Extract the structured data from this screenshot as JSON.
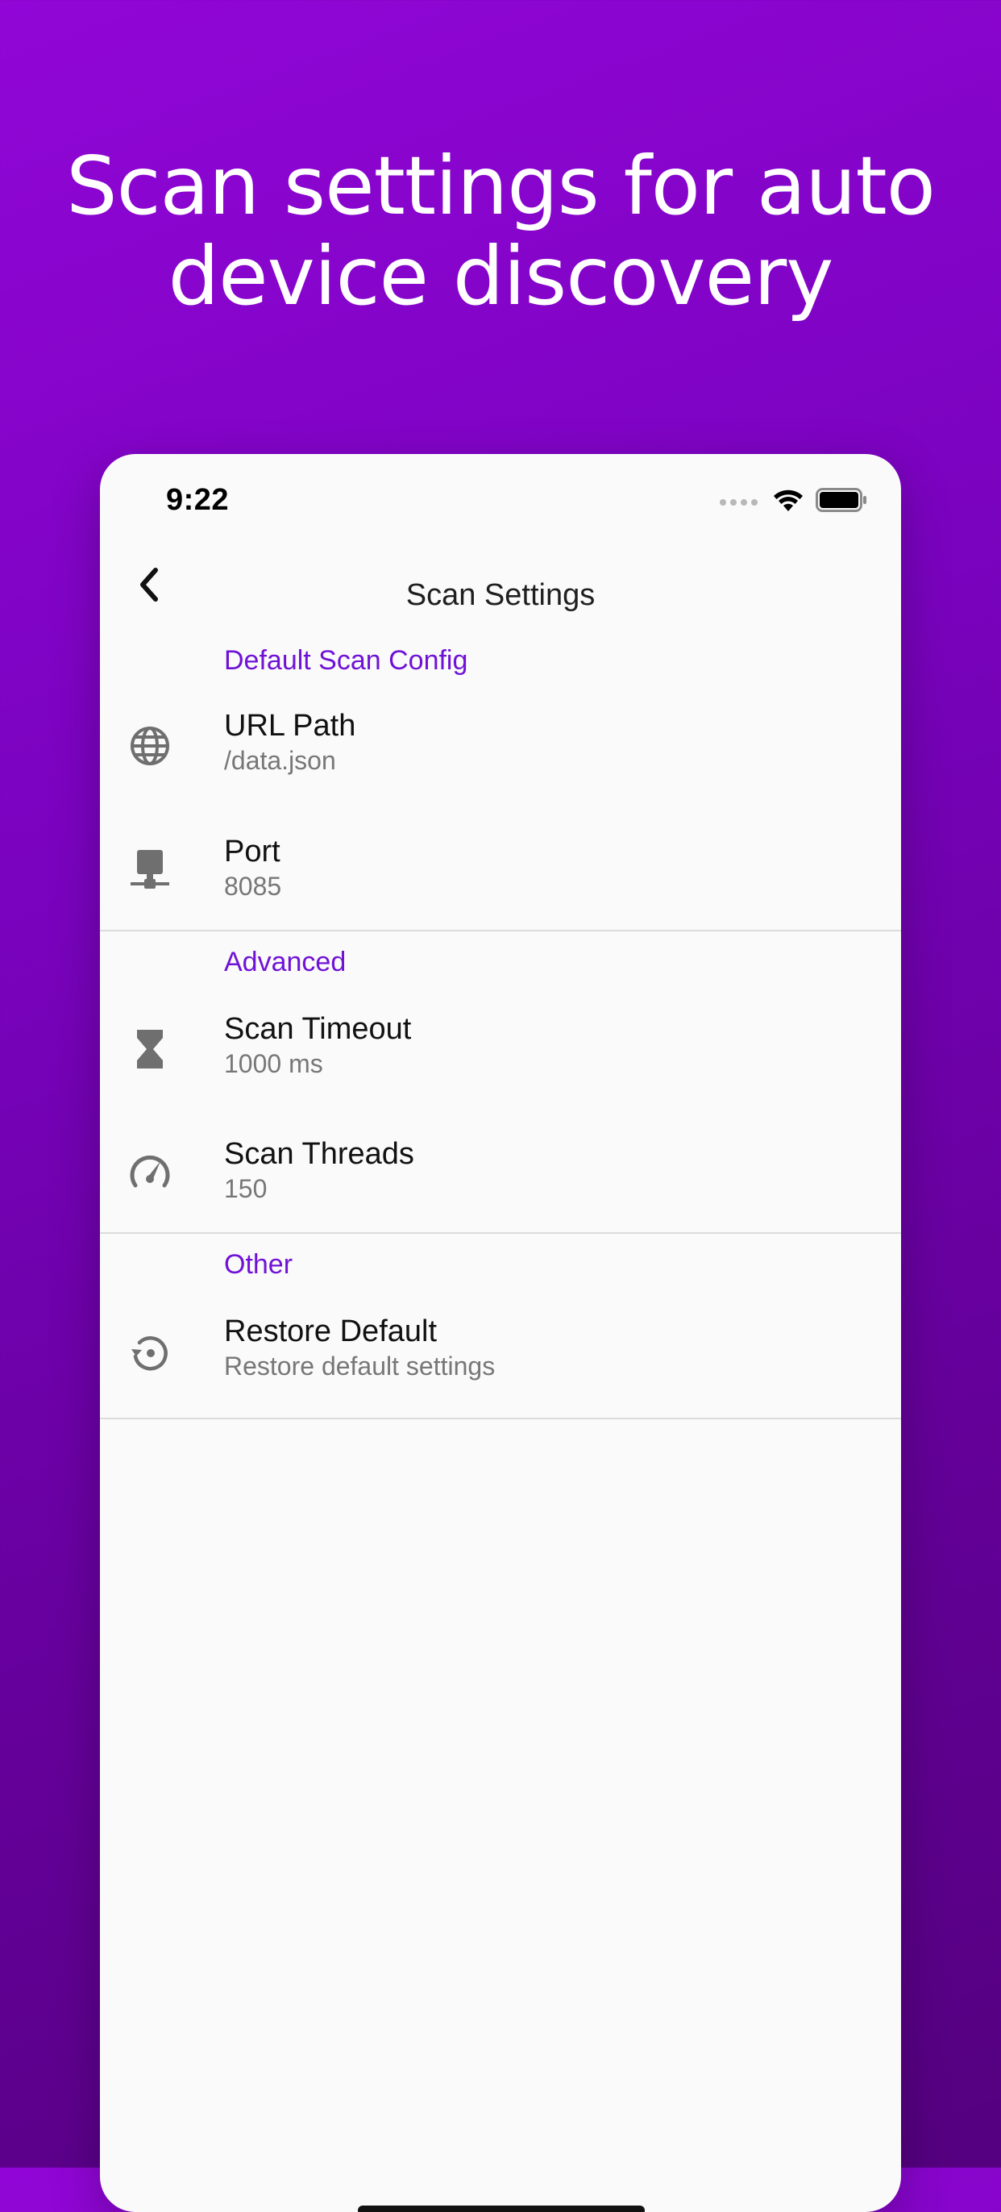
{
  "headline": {
    "line1": "Scan settings for auto",
    "line2": "device discovery"
  },
  "status_bar": {
    "time": "9:22",
    "icons": [
      "cellular-signal-icon",
      "wifi-icon",
      "battery-icon"
    ]
  },
  "nav": {
    "title": "Scan Settings",
    "back_icon": "chevron-left-icon"
  },
  "colors": {
    "accent": "#7012d6",
    "background_gradient_start": "#9106d6",
    "background_gradient_end": "#54007f",
    "icon_gray": "#6f6f6f"
  },
  "sections": [
    {
      "header": "Default Scan Config",
      "items": [
        {
          "title": "URL Path",
          "subtitle": "/data.json",
          "icon": "globe-icon"
        },
        {
          "title": "Port",
          "subtitle": "8085",
          "icon": "network-port-icon"
        }
      ]
    },
    {
      "header": "Advanced",
      "items": [
        {
          "title": "Scan Timeout",
          "subtitle": "1000 ms",
          "icon": "hourglass-icon"
        },
        {
          "title": "Scan Threads",
          "subtitle": "150",
          "icon": "speedometer-icon"
        }
      ]
    },
    {
      "header": "Other",
      "items": [
        {
          "title": "Restore Default",
          "subtitle": "Restore default settings",
          "icon": "restore-icon"
        }
      ]
    }
  ]
}
